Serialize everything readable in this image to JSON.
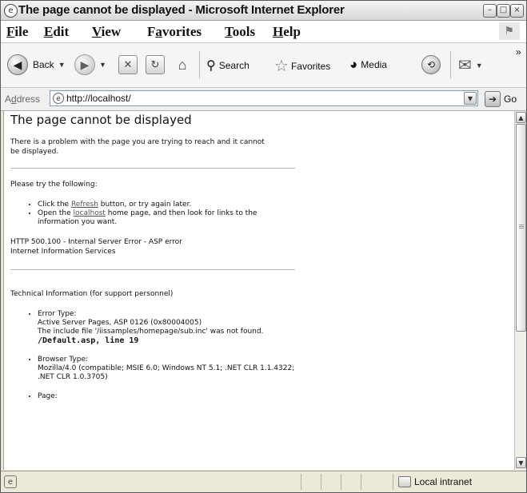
{
  "window": {
    "title": "The page cannot be displayed - Microsoft Internet Explorer"
  },
  "menu": {
    "file": {
      "accel": "F",
      "rest": "ile"
    },
    "edit": {
      "accel": "E",
      "rest": "dit"
    },
    "view": {
      "accel": "V",
      "rest": "iew"
    },
    "favorites": {
      "pre": "F",
      "accel": "a",
      "rest": "vorites"
    },
    "tools": {
      "accel": "T",
      "rest": "ools"
    },
    "help": {
      "accel": "H",
      "rest": "elp"
    }
  },
  "toolbar": {
    "back_label": "Back",
    "search_label": "Search",
    "favorites_label": "Favorites",
    "media_label": "Media",
    "overflow": "»"
  },
  "address": {
    "label_accel": "d",
    "label_pre": "A",
    "label_rest": "dress",
    "url": "http://localhost/",
    "go_label": "Go"
  },
  "page": {
    "heading": "The page cannot be displayed",
    "intro": "There is a problem with the page you are trying to reach and it cannot be displayed.",
    "try_heading": "Please try the following:",
    "bullet1_pre": "Click the ",
    "bullet1_link": "Refresh",
    "bullet1_post": " button, or try again later.",
    "bullet2_pre": "Open the ",
    "bullet2_link": "localhost",
    "bullet2_post": " home page, and then look for links to the information you want.",
    "error_code": "HTTP 500.100 - Internal Server Error - ASP error",
    "server": "Internet Information Services",
    "tech_heading": "Technical Information (for support personnel)",
    "error_type_label": "Error Type:",
    "error_type_line1": "Active Server Pages, ASP 0126 (0x80004005)",
    "error_type_line2": "The include file '/iissamples/homepage/sub.inc' was not found.",
    "error_location": "/Default.asp, line 19",
    "browser_type_label": "Browser Type:",
    "browser_type_value": "Mozilla/4.0 (compatible; MSIE 6.0; Windows NT 5.1; .NET CLR 1.1.4322; .NET CLR 1.0.3705)",
    "page_label": "Page:"
  },
  "status": {
    "zone": "Local intranet"
  },
  "icons": [
    "ie-icon",
    "minimize-icon",
    "maximize-icon",
    "close-icon",
    "windows-logo-icon",
    "back-icon",
    "forward-icon",
    "stop-icon",
    "refresh-icon",
    "home-icon",
    "search-icon",
    "favorites-icon",
    "media-icon",
    "history-icon",
    "mail-icon",
    "go-icon",
    "scroll-up-icon",
    "scroll-down-icon",
    "local-intranet-icon"
  ]
}
